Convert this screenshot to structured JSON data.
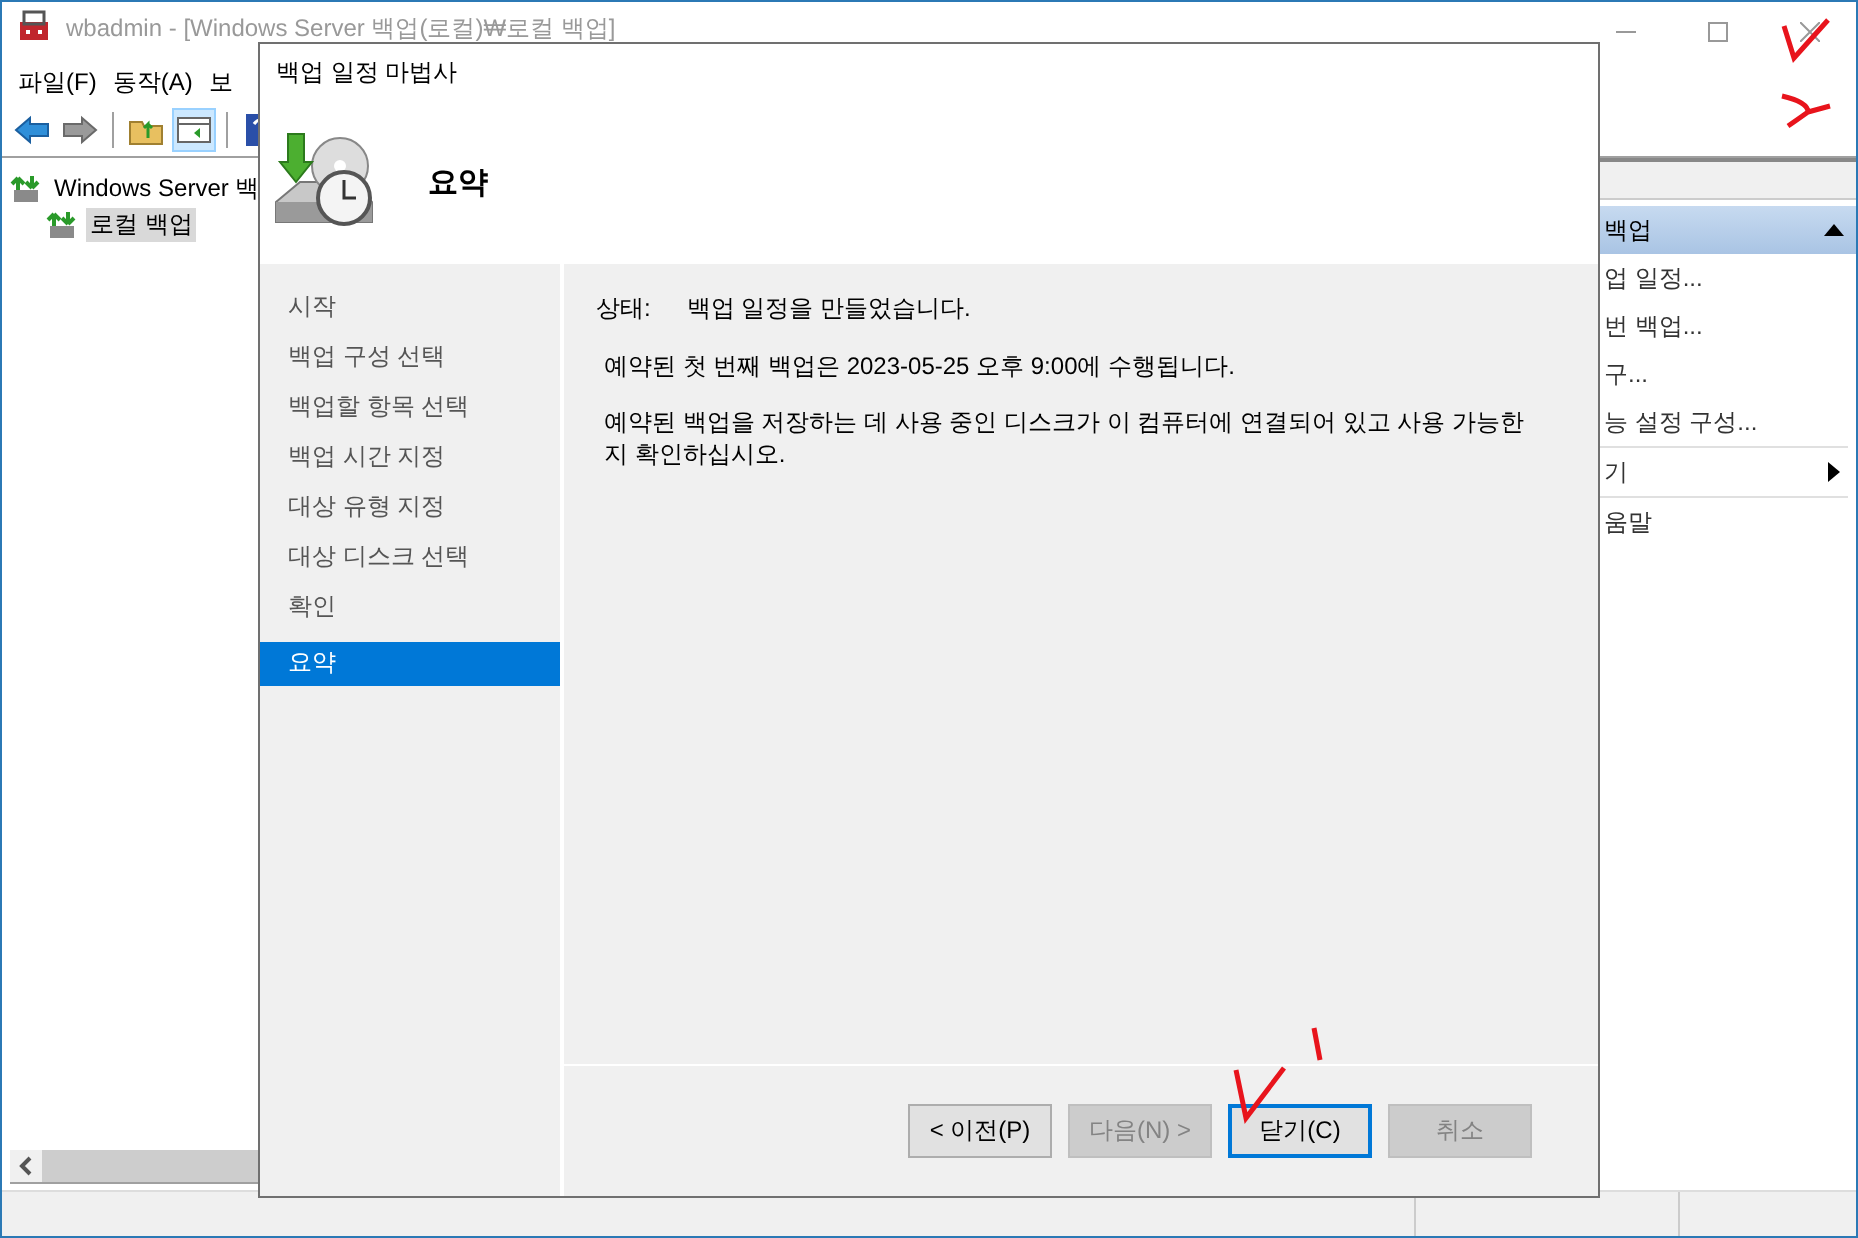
{
  "main_window": {
    "title": "wbadmin - [Windows Server 백업(로컬)₩로컬 백업]",
    "menu": [
      "파일(F)",
      "동작(A)",
      "보"
    ],
    "tree": [
      {
        "label": "Windows Server 백",
        "selected": false,
        "children": [
          {
            "label": "로컬 백업",
            "selected": true
          }
        ]
      }
    ],
    "actions": {
      "header": "백업",
      "items": [
        {
          "kind": "action",
          "label": "업 일정..."
        },
        {
          "kind": "action",
          "label": "번 백업..."
        },
        {
          "kind": "action",
          "label": "구..."
        },
        {
          "kind": "action",
          "label": "능 설정 구성..."
        },
        {
          "kind": "submenu",
          "label": "기"
        },
        {
          "kind": "action",
          "label": "움말"
        }
      ]
    }
  },
  "dialog": {
    "title": "백업 일정 마법사",
    "heading": "요약",
    "steps": [
      {
        "label": "시작",
        "selected": false
      },
      {
        "label": "백업 구성 선택",
        "selected": false
      },
      {
        "label": "백업할 항목 선택",
        "selected": false
      },
      {
        "label": "백업 시간 지정",
        "selected": false
      },
      {
        "label": "대상 유형 지정",
        "selected": false
      },
      {
        "label": "대상 디스크 선택",
        "selected": false
      },
      {
        "label": "확인",
        "selected": false
      },
      {
        "label": "요약",
        "selected": true
      }
    ],
    "status_label": "상태:",
    "status_value": "백업 일정을 만들었습니다.",
    "messages": [
      "예약된 첫 번째 백업은 2023-05-25 오후 9:00에 수행됩니다.",
      "예약된 백업을 저장하는 데 사용 중인 디스크가 이 컴퓨터에 연결되어 있고 사용 가능한지 확인하십시오."
    ],
    "buttons": [
      {
        "label": "< 이전(P)",
        "disabled": false,
        "focused": false
      },
      {
        "label": "다음(N) >",
        "disabled": true,
        "focused": false
      },
      {
        "label": "닫기(C)",
        "disabled": false,
        "focused": true
      },
      {
        "label": "취소",
        "disabled": true,
        "focused": false
      }
    ]
  }
}
